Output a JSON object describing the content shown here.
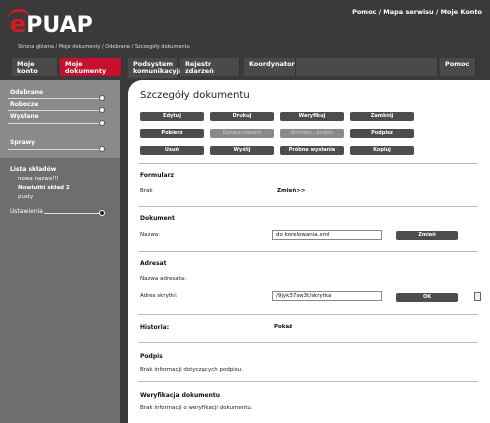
{
  "header": {
    "logo_prefix": "e",
    "logo_text": "PUAP",
    "top_links": "Pomoc / Mapa serwisu / Moje Konto",
    "breadcrumb": "Strona główna / Moje dokumenty / Odebrane / Szczegóły dokumentu"
  },
  "nav": {
    "items": [
      {
        "label": "Moje konto"
      },
      {
        "label": "Moje dokumenty"
      },
      {
        "label": "Podsystem\nkomunikacyjny"
      },
      {
        "label": "Rejestr zdarzeń"
      },
      {
        "label": "Koordynator"
      },
      {
        "label": "Pomoc"
      }
    ]
  },
  "sidebar": {
    "items": [
      {
        "label": "Odebrane"
      },
      {
        "label": "Robocze"
      },
      {
        "label": "Wysłane"
      },
      {
        "label": "Sprawy"
      }
    ],
    "lista_title": "Lista składów",
    "lista_items": [
      {
        "label": "nowa nazwa!!!"
      },
      {
        "label": "Nowiutki skład 2"
      },
      {
        "label": "pusty"
      }
    ],
    "ustawienia": "Ustawienia"
  },
  "main": {
    "title": "Szczegóły dokumentu",
    "buttons": [
      {
        "label": "Edytuj",
        "disabled": false
      },
      {
        "label": "Drukuj",
        "disabled": false
      },
      {
        "label": "Weryfikuj",
        "disabled": false
      },
      {
        "label": "Zamknij",
        "disabled": false
      },
      {
        "label": "Pobierz",
        "disabled": false
      },
      {
        "label": "Oznacz czasem",
        "disabled": true
      },
      {
        "label": "Archiwiz...podpis",
        "disabled": true
      },
      {
        "label": "Podpisz",
        "disabled": false
      },
      {
        "label": "Usuń",
        "disabled": false
      },
      {
        "label": "Wyślij",
        "disabled": false
      },
      {
        "label": "Próbne wysłanie",
        "disabled": false
      },
      {
        "label": "Kopiuj",
        "disabled": false
      }
    ],
    "formularz": {
      "title": "Formularz",
      "value": "Brak",
      "change": "Zmień>>"
    },
    "dokument": {
      "title": "Dokument",
      "name_label": "Nazwa:",
      "name_value": "do korelowania.xml",
      "change_btn": "Zmień"
    },
    "adresat": {
      "title": "Adresat",
      "name_label": "Nazwa adresata:",
      "box_label": "Adres skrytki:",
      "box_value": "/9jyk37sw3t/skrytka",
      "ok_btn": "OK"
    },
    "historia": {
      "title": "Historia:",
      "show": "Pokaż"
    },
    "podpis": {
      "title": "Podpis",
      "text": "Brak informacji dotyczących podpisu."
    },
    "weryfikacja": {
      "title": "Weryfikacja dokumentu",
      "text": "Brak informacji o weryfikacji dokumentu."
    }
  }
}
